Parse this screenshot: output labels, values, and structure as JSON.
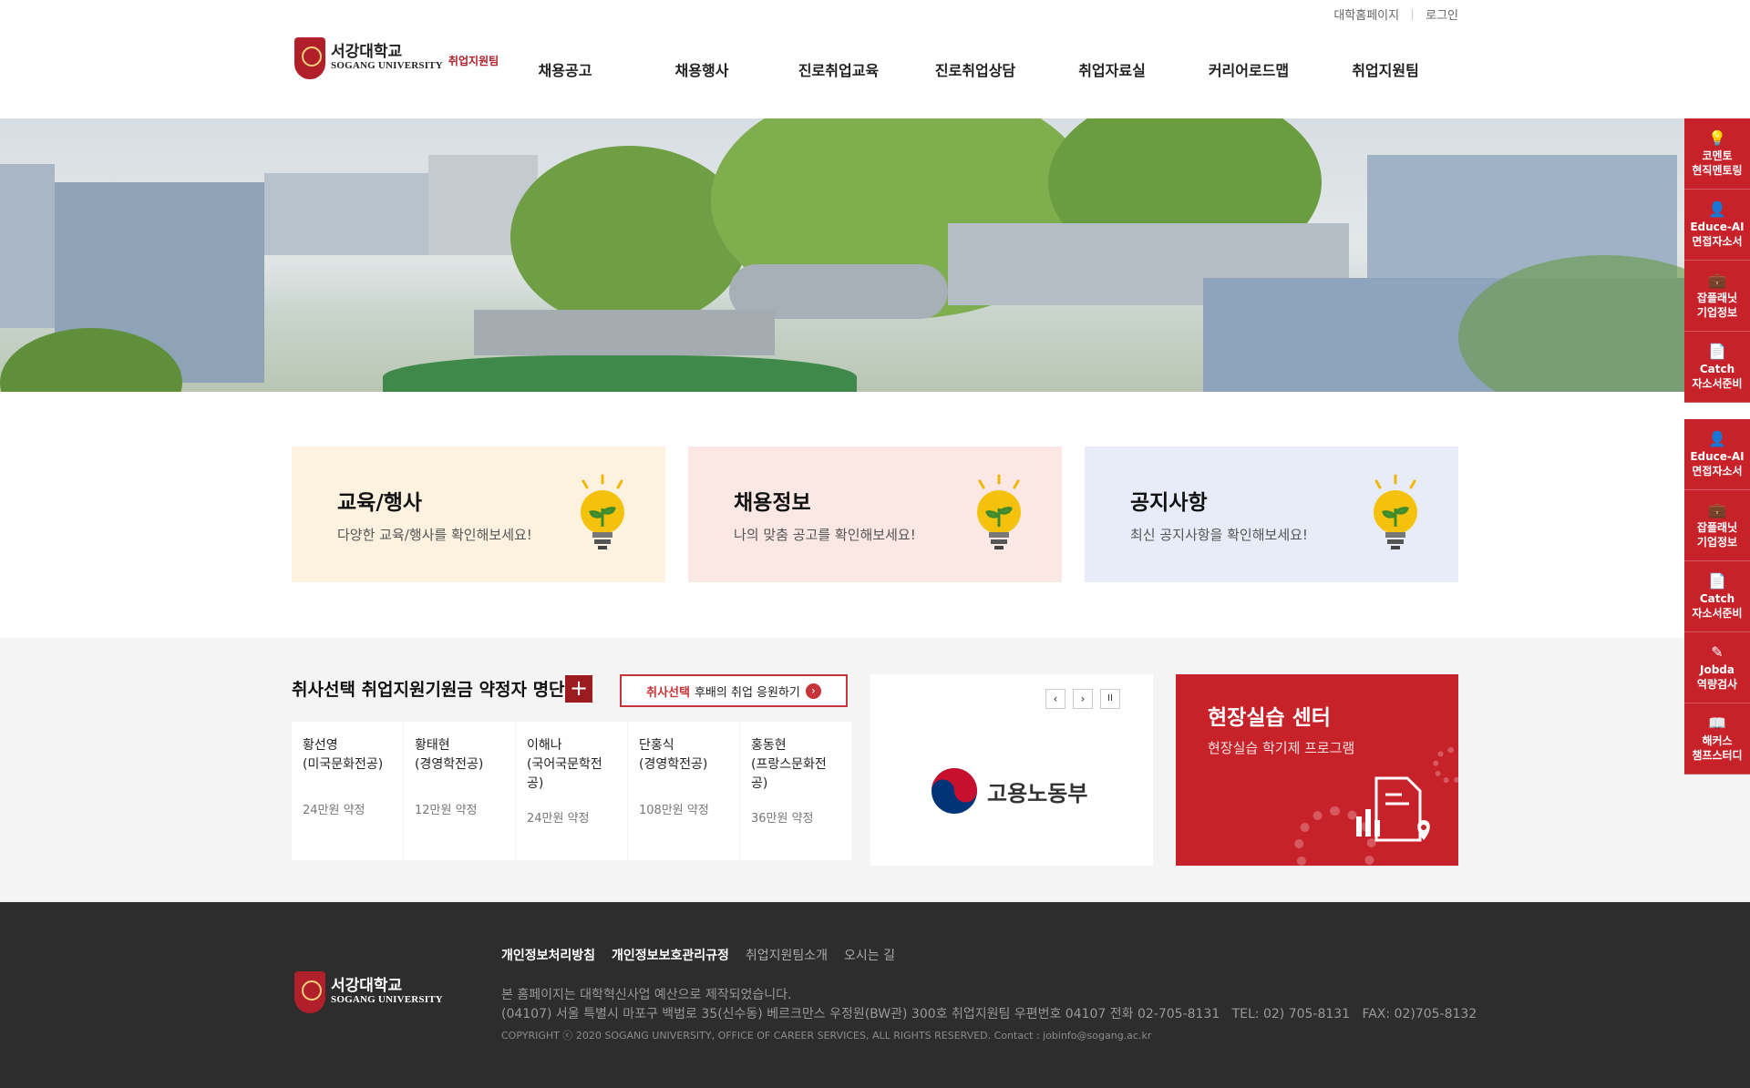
{
  "utility": {
    "home_link": "대학홈페이지",
    "login_link": "로그인"
  },
  "logo": {
    "ko": "서강대학교",
    "en": "SOGANG UNIVERSITY",
    "dept": "취업지원팀"
  },
  "gnb": [
    "채용공고",
    "채용행사",
    "진로취업교육",
    "진로취업상담",
    "취업자료실",
    "커리어로드맵",
    "취업지원팀"
  ],
  "cards": [
    {
      "title": "교육/행사",
      "desc": "다양한 교육/행사를 확인해보세요!",
      "bg": "#fdf1df"
    },
    {
      "title": "채용정보",
      "desc": "나의 맞춤 공고를 확인해보세요!",
      "bg": "#fbe7e4"
    },
    {
      "title": "공지사항",
      "desc": "최신 공지사항을 확인해보세요!",
      "bg": "#e7ecf8"
    }
  ],
  "donations": {
    "title": "취사선택 취업지원기원금 약정자 명단",
    "plus": "+",
    "support_highlight": "취사선택",
    "support_text": "후배의 취업 응원하기",
    "donors": [
      {
        "name": "황선영\n(미국문화전공)",
        "amount": "24만원 약정"
      },
      {
        "name": "황태현\n(경영학전공)",
        "amount": "12만원 약정"
      },
      {
        "name": "이해나\n(국어국문학전\n공)",
        "amount": "24만원 약정"
      },
      {
        "name": "단홍식\n(경영학전공)",
        "amount": "108만원 약정"
      },
      {
        "name": "홍동현\n(프랑스문화전\n공)",
        "amount": "36만원 약정"
      }
    ]
  },
  "banner": {
    "org": "고용노동부",
    "prev": "‹",
    "next": "›",
    "pause": "II"
  },
  "field_center": {
    "title": "현장실습 센터",
    "desc": "현장실습 학기제 프로그램"
  },
  "footer": {
    "links": [
      "개인정보처리방침",
      "개인정보보호관리규정",
      "취업지원팀소개",
      "오시는 길"
    ],
    "notice": "본 홈페이지는 대학혁신사업 예산으로 제작되었습니다.",
    "address": "(04107) 서울 특별시 마포구 백범로 35(신수동) 베르크만스 우정원(BW관) 300호 취업지원팀 우편번호 04107 전화 02-705-8131   TEL: 02) 705-8131   FAX: 02)705-8132",
    "copyright": "COPYRIGHT ⓒ 2020 SOGANG UNIVERSITY, OFFICE OF CAREER SERVICES, ALL RIGHTS RESERVED. Contact : jobinfo@sogang.ac.kr"
  },
  "quick_menu": [
    {
      "icon": "lightbulb-icon",
      "glyph": "💡",
      "line1": "코멘토",
      "line2": "현직멘토링"
    },
    {
      "icon": "person-icon",
      "glyph": "👤",
      "line1": "Educe-AI",
      "line2": "면접자소서"
    },
    {
      "icon": "briefcase-icon",
      "glyph": "💼",
      "line1": "잡플래닛",
      "line2": "기업정보"
    },
    {
      "icon": "document-icon",
      "glyph": "📄",
      "line1": "Catch",
      "line2": "자소서준비"
    },
    {
      "icon": "person-icon",
      "glyph": "👤",
      "line1": "Educe-AI",
      "line2": "면접자소서"
    },
    {
      "icon": "briefcase-icon",
      "glyph": "💼",
      "line1": "잡플래닛",
      "line2": "기업정보"
    },
    {
      "icon": "document-icon",
      "glyph": "📄",
      "line1": "Catch",
      "line2": "자소서준비"
    },
    {
      "icon": "pencil-icon",
      "glyph": "✎",
      "line1": "Jobda",
      "line2": "역량검사"
    },
    {
      "icon": "book-icon",
      "glyph": "📖",
      "line1": "해커스",
      "line2": "챔프스터디"
    }
  ],
  "colors": {
    "brand_red": "#c7222a",
    "dark_red": "#9b1b1f",
    "footer_bg": "#2d2d2d"
  }
}
